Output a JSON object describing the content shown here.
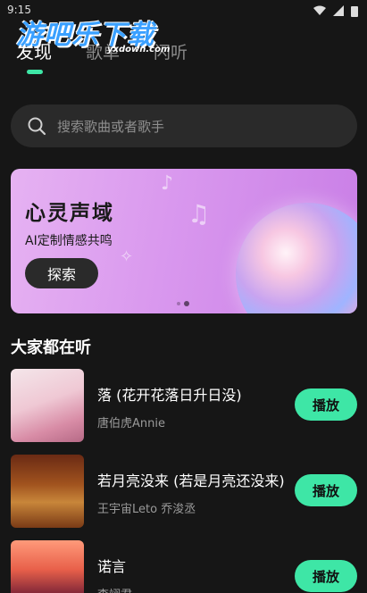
{
  "status_bar": {
    "time": "9:15"
  },
  "watermark": {
    "text": "游吧乐下载",
    "sub": "yxdown.com"
  },
  "tabs": [
    {
      "label": "发现",
      "active": true
    },
    {
      "label": "歌单",
      "active": false
    },
    {
      "label": "闪听",
      "active": false
    }
  ],
  "search": {
    "placeholder": "搜索歌曲或者歌手"
  },
  "banner": {
    "title": "心灵声域",
    "subtitle": "AI定制情感共鸣",
    "button": "探索",
    "page_count": 2,
    "active_page": 2
  },
  "section": {
    "title": "大家都在听"
  },
  "songs": [
    {
      "title": "落 (花开花落日升日没)",
      "artist": "唐伯虎Annie",
      "play_label": "播放"
    },
    {
      "title": "若月亮没来 (若是月亮还没来)",
      "artist": "王宇宙Leto 乔浚丞",
      "play_label": "播放"
    },
    {
      "title": "诺言",
      "artist": "李翊君",
      "play_label": "播放"
    }
  ],
  "colors": {
    "accent": "#3ee6a6",
    "background": "#161616",
    "banner": "#d998ee"
  }
}
